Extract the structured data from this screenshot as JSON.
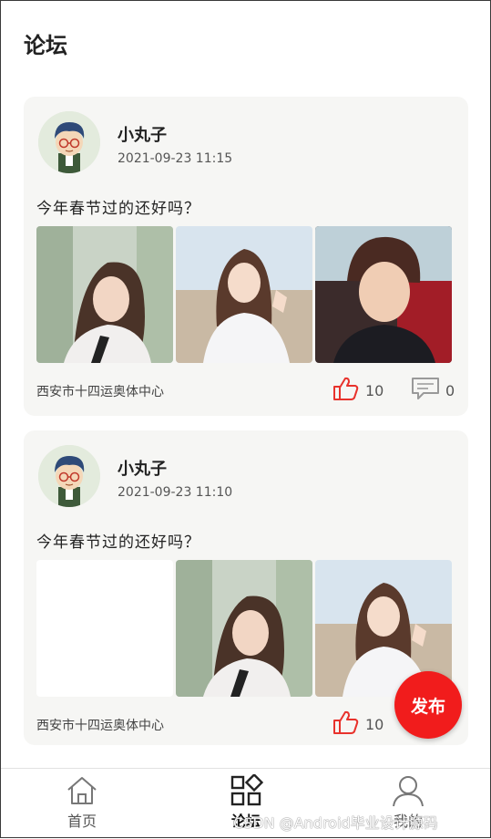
{
  "header": {
    "title": "论坛"
  },
  "posts": [
    {
      "user": "小丸子",
      "time": "2021-09-23 11:15",
      "text": "今年春节过的还好吗？",
      "location": "西安市十四运奥体中心",
      "likes": "10",
      "comments": "0"
    },
    {
      "user": "小丸子",
      "time": "2021-09-23 11:10",
      "text": "今年春节过的还好吗？",
      "location": "西安市十四运奥体中心",
      "likes": "10"
    }
  ],
  "fab": {
    "label": "发布"
  },
  "tabbar": {
    "items": [
      {
        "label": "首页"
      },
      {
        "label": "论坛"
      },
      {
        "label": "我的"
      }
    ]
  },
  "watermark": "CSDN @Android毕业设计源码",
  "colors": {
    "accent": "#f11c1c",
    "card_bg": "#f6f6f4",
    "like": "#e8322c"
  }
}
